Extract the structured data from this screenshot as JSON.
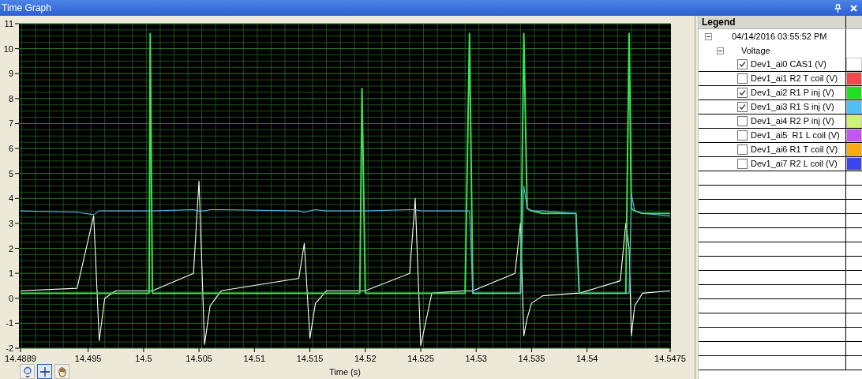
{
  "window": {
    "title": "Time Graph"
  },
  "graph": {
    "chart_data": {
      "type": "line",
      "xlabel": "Time (s)",
      "xlim": [
        14.4889,
        14.5475
      ],
      "ylim": [
        -2,
        11
      ],
      "x": [
        14.4889,
        14.494,
        14.4955,
        14.496,
        14.4965,
        14.4975,
        14.5,
        14.5005,
        14.5006,
        14.5008,
        14.5045,
        14.505,
        14.5055,
        14.506,
        14.507,
        14.514,
        14.5145,
        14.515,
        14.5155,
        14.5165,
        14.5195,
        14.5197,
        14.52,
        14.524,
        14.5245,
        14.525,
        14.526,
        14.529,
        14.5294,
        14.5297,
        14.5335,
        14.534,
        14.5343,
        14.5346,
        14.535,
        14.536,
        14.539,
        14.5393,
        14.543,
        14.5435,
        14.5438,
        14.544,
        14.5443,
        14.545,
        14.5475
      ],
      "series": [
        {
          "color": "#ffffff",
          "values": [
            0.3,
            0.4,
            3.3,
            -1.7,
            0.0,
            0.3,
            0.3,
            0.3,
            0.3,
            0.3,
            1.0,
            4.7,
            -1.85,
            -0.3,
            0.3,
            0.8,
            2.2,
            -1.6,
            -0.2,
            0.3,
            0.3,
            0.3,
            0.3,
            1.0,
            4.0,
            -1.9,
            0.2,
            0.3,
            0.3,
            0.3,
            1.0,
            3.0,
            -1.5,
            -0.8,
            -0.2,
            0.1,
            0.2,
            0.2,
            0.7,
            3.0,
            2.0,
            -1.5,
            -0.3,
            0.2,
            0.3
          ]
        },
        {
          "color": "#3ce050",
          "values": [
            0.2,
            0.2,
            0.2,
            0.2,
            0.2,
            0.2,
            0.2,
            0.2,
            10.6,
            0.2,
            0.2,
            0.2,
            0.2,
            0.2,
            0.2,
            0.2,
            0.2,
            0.2,
            0.2,
            0.2,
            0.2,
            8.4,
            0.2,
            0.2,
            0.2,
            0.2,
            0.2,
            0.2,
            10.6,
            0.2,
            0.2,
            0.2,
            10.6,
            3.6,
            3.5,
            3.4,
            3.4,
            0.2,
            0.2,
            0.2,
            10.6,
            3.6,
            3.5,
            3.4,
            3.4
          ]
        },
        {
          "color": "#5ab8e8",
          "values": [
            3.5,
            3.45,
            3.35,
            3.5,
            3.5,
            3.5,
            3.5,
            3.5,
            3.5,
            3.5,
            3.55,
            3.5,
            3.5,
            3.55,
            3.55,
            3.5,
            3.45,
            3.5,
            3.55,
            3.5,
            3.5,
            3.5,
            3.5,
            3.55,
            3.55,
            3.5,
            3.5,
            3.5,
            3.5,
            0.2,
            0.2,
            0.2,
            4.5,
            3.6,
            3.5,
            3.5,
            3.4,
            0.2,
            0.2,
            0.2,
            0.2,
            4.2,
            3.5,
            3.4,
            3.3
          ]
        }
      ],
      "xticks": [
        {
          "value": 14.4889,
          "label": "14.4889"
        },
        {
          "value": 14.495,
          "label": "14.495"
        },
        {
          "value": 14.5,
          "label": "14.5"
        },
        {
          "value": 14.505,
          "label": "14.505"
        },
        {
          "value": 14.51,
          "label": "14.51"
        },
        {
          "value": 14.515,
          "label": "14.515"
        },
        {
          "value": 14.52,
          "label": "14.52"
        },
        {
          "value": 14.525,
          "label": "14.525"
        },
        {
          "value": 14.53,
          "label": "14.53"
        },
        {
          "value": 14.535,
          "label": "14.535"
        },
        {
          "value": 14.54,
          "label": "14.54"
        },
        {
          "value": 14.5475,
          "label": "14.5475"
        }
      ],
      "yticks": [
        -2,
        -1,
        0,
        1,
        2,
        3,
        4,
        5,
        6,
        7,
        8,
        9,
        10,
        11
      ],
      "grid": true
    },
    "tools": [
      {
        "kind": "zoom",
        "selected": false
      },
      {
        "kind": "cursor",
        "selected": true
      },
      {
        "kind": "pan",
        "selected": false
      }
    ]
  },
  "legend": {
    "title": "Legend",
    "items": [
      {
        "label": "04/14/2016 03:55:52 PM",
        "expanded": true,
        "children": [
          {
            "label": "Voltage",
            "expanded": true,
            "children": [
              {
                "label": "Dev1_ai0 CAS1 (V)",
                "checked": true,
                "color": "#ffffff"
              },
              {
                "label": "Dev1_ai1 R2 T coil (V)",
                "checked": false,
                "color": "#f04848"
              },
              {
                "label": "Dev1_ai2 R1 P inj (V)",
                "checked": true,
                "color": "#1ee01e"
              },
              {
                "label": "Dev1_ai3 R1 S inj (V)",
                "checked": true,
                "color": "#50c0f4"
              },
              {
                "label": "Dev1_ai4 R2 P inj (V)",
                "checked": false,
                "color": "#ccf472"
              },
              {
                "label": "Dev1_ai5  R1 L coil (V)",
                "checked": false,
                "color": "#c454f4"
              },
              {
                "label": "Dev1_ai6 R1 T coil (V)",
                "checked": false,
                "color": "#f8aa10"
              },
              {
                "label": "Dev1_ai7 R2 L coil (V)",
                "checked": false,
                "color": "#3c44ec"
              }
            ]
          }
        ]
      }
    ]
  }
}
